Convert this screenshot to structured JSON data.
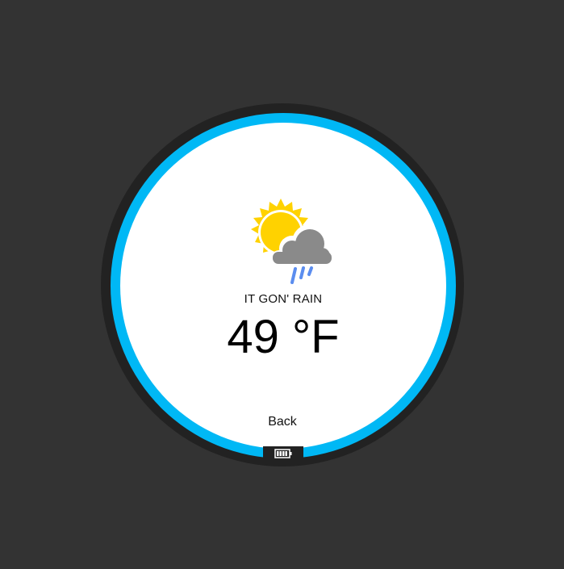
{
  "weather": {
    "icon": "partly-sunny-rain-icon",
    "condition": "IT GON' RAIN",
    "temperature": "49 °F"
  },
  "controls": {
    "back_label": "Back"
  },
  "status": {
    "battery_icon": "battery-icon"
  },
  "colors": {
    "background": "#333333",
    "bezel": "#222222",
    "ring": "#00B8F5",
    "face": "#FFFFFF",
    "sun": "#FFD200",
    "cloud": "#8A8A8A",
    "rain": "#5B8DEF"
  }
}
